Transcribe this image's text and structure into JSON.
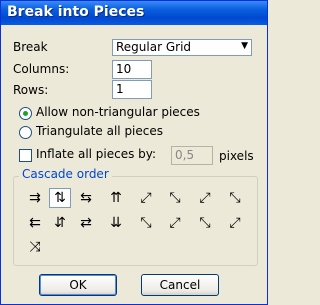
{
  "window": {
    "title": "Break into Pieces"
  },
  "form": {
    "break_label": "Break",
    "break_value": "Regular Grid",
    "columns_label": "Columns:",
    "columns_value": "10",
    "rows_label": "Rows:",
    "rows_value": "1",
    "radio_allow": "Allow non-triangular pieces",
    "radio_triangulate": "Triangulate all pieces",
    "inflate_label": "Inflate all pieces by:",
    "inflate_value": "0,5",
    "inflate_unit": "pixels"
  },
  "cascade": {
    "title": "Cascade order",
    "icons": [
      {
        "name": "cascade-right-icon",
        "glyph": "⇉"
      },
      {
        "name": "cascade-vertical-icon",
        "glyph": "⇅"
      },
      {
        "name": "cascade-horizontal-icon",
        "glyph": "⇆"
      },
      {
        "name": "cascade-up-icon",
        "glyph": "⇈"
      },
      {
        "name": "cascade-diag-1-icon",
        "glyph": "⤢"
      },
      {
        "name": "cascade-diag-2-icon",
        "glyph": "⤡"
      },
      {
        "name": "cascade-diag-3-icon",
        "glyph": "⤢"
      },
      {
        "name": "cascade-diag-4-icon",
        "glyph": "⤡"
      },
      {
        "name": "cascade-left-icon",
        "glyph": "⇇"
      },
      {
        "name": "cascade-vertical-2-icon",
        "glyph": "⇵"
      },
      {
        "name": "cascade-horizontal-2-icon",
        "glyph": "⇄"
      },
      {
        "name": "cascade-down-icon",
        "glyph": "⇊"
      },
      {
        "name": "cascade-diag-5-icon",
        "glyph": "⤡"
      },
      {
        "name": "cascade-diag-6-icon",
        "glyph": "⤢"
      },
      {
        "name": "cascade-diag-7-icon",
        "glyph": "⤡"
      },
      {
        "name": "cascade-diag-8-icon",
        "glyph": "⤢"
      },
      {
        "name": "cascade-random-icon",
        "glyph": "⤨"
      }
    ]
  },
  "buttons": {
    "ok": "OK",
    "cancel": "Cancel"
  }
}
